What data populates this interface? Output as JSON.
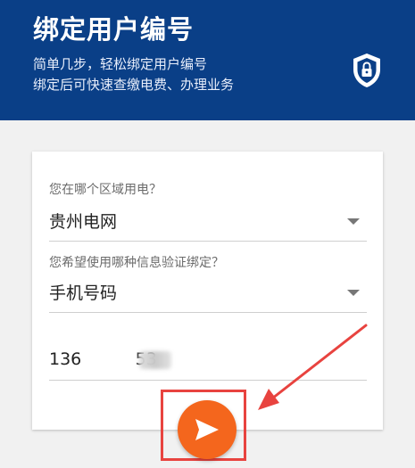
{
  "header": {
    "title": "绑定用户编号",
    "subtitle_line1": "简单几步，轻松绑定用户编号",
    "subtitle_line2": "绑定后可快速查缴电费、办理业务",
    "shield_icon": "shield-lock-icon"
  },
  "form": {
    "region": {
      "label": "您在哪个区域用电？",
      "value": "贵州电网"
    },
    "verify_method": {
      "label": "您希望使用哪种信息验证绑定？",
      "value": "手机号码"
    },
    "phone": {
      "value": "136          53"
    },
    "submit_icon": "send-arrow-icon"
  },
  "colors": {
    "header_bg": "#0a3f87",
    "accent_orange": "#f4661d",
    "annotation_red": "#e8433f"
  }
}
